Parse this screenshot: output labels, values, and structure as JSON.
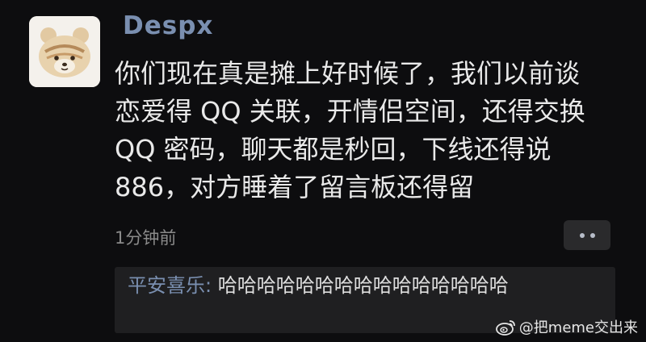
{
  "post": {
    "username": "Despx",
    "lines": [
      "你们现在真是摊上好时候了，我们以前谈",
      "恋爱得 QQ 关联，开情侣空间，还得交换",
      "QQ 密码，聊天都是秒回，下线还得说",
      "886，对方睡着了留言板还得留"
    ],
    "timestamp": "1分钟前"
  },
  "comment": {
    "author": "平安喜乐:",
    "text": "哈哈哈哈哈哈哈哈哈哈哈哈哈哈哈"
  },
  "watermark": {
    "text": "@把meme交出来",
    "logo_icon": "weibo-icon"
  },
  "colors": {
    "background": "#0d0d0f",
    "username": "#7a8fb0",
    "body_text": "#e9e9e9",
    "comment_bg": "#1f1f21"
  }
}
